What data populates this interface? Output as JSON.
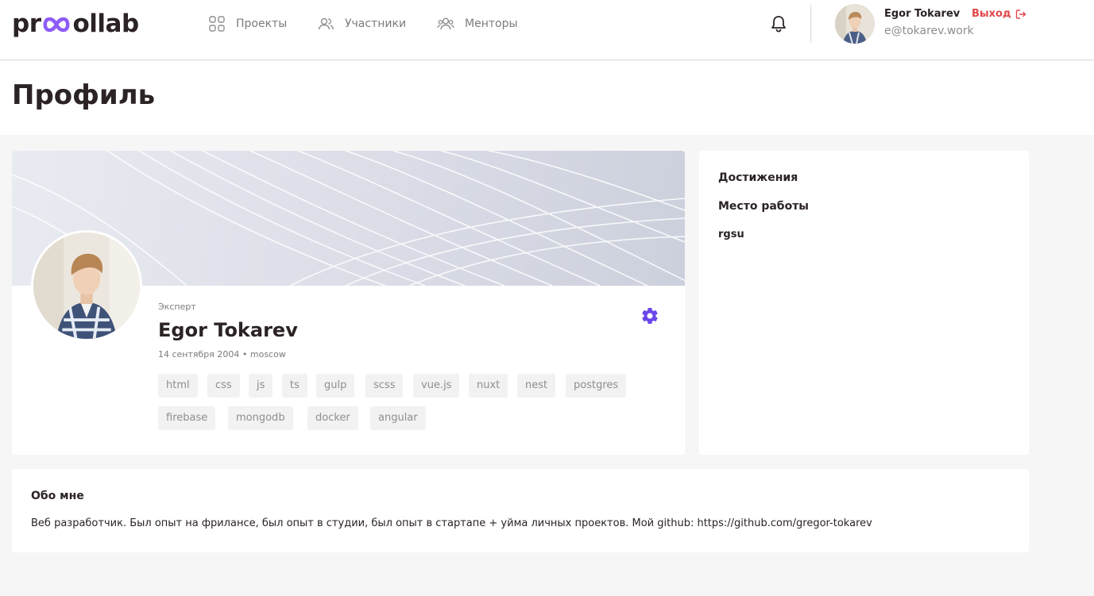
{
  "header": {
    "logo": {
      "left": "pr",
      "right": "ollab"
    },
    "nav": [
      {
        "label": "Проекты",
        "icon": "grid-icon"
      },
      {
        "label": "Участники",
        "icon": "users-icon"
      },
      {
        "label": "Менторы",
        "icon": "mentors-icon"
      }
    ],
    "user": {
      "name": "Egor Tokarev",
      "email": "e@tokarev.work",
      "logout_label": "Выход"
    }
  },
  "page": {
    "title": "Профиль"
  },
  "profile": {
    "role": "Эксперт",
    "name": "Egor Tokarev",
    "meta": "14 сентября 2004 • moscow",
    "skills": [
      "html",
      "css",
      "js",
      "ts",
      "gulp",
      "scss",
      "vue.js",
      "nuxt",
      "nest",
      "postgres",
      "firebase",
      "mongodb",
      "docker",
      "angular"
    ]
  },
  "side": {
    "achievements_title": "Достижения",
    "work_title": "Место работы",
    "work_value": "rgsu"
  },
  "about": {
    "title": "Обо мне",
    "text": "Веб разработчик. Был опыт на фрилансе, был опыт в студии, был опыт в стартапе + уйма личных проектов. Мой github: https://github.com/gregor-tokarev"
  },
  "colors": {
    "accent": "#7b4cf5",
    "logout": "#e2484b",
    "text": "#2b2324",
    "muted": "#8e8e8e"
  }
}
